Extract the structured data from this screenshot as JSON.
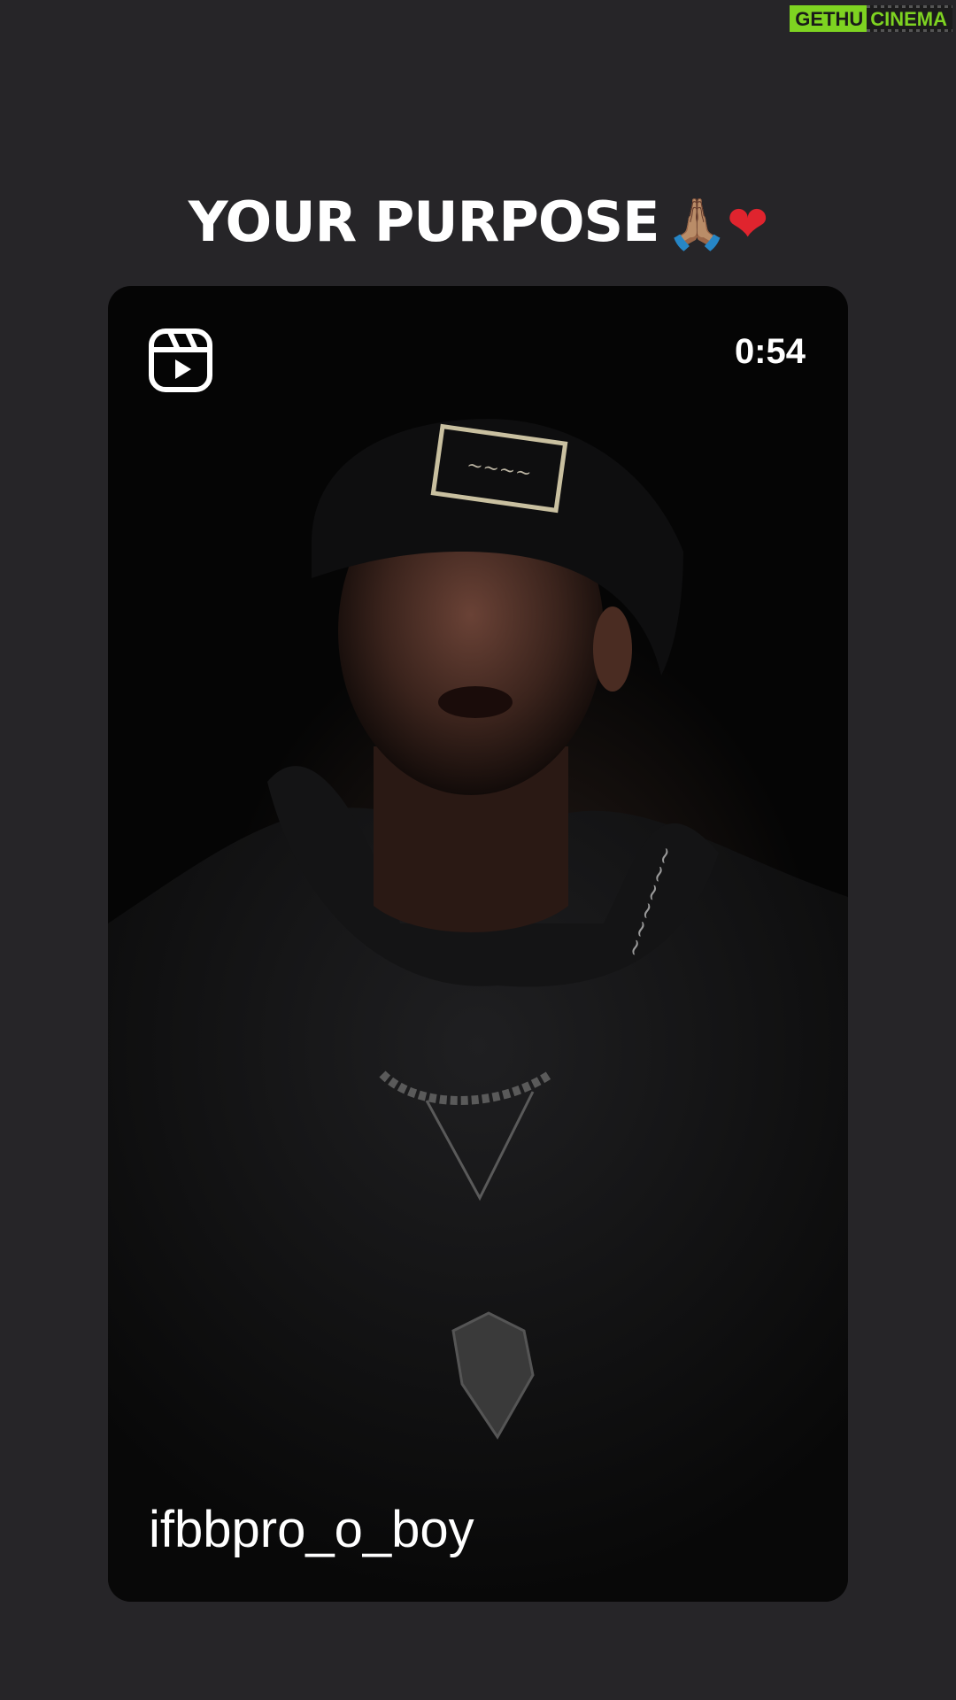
{
  "watermark": {
    "part1": "GETHU",
    "part2": "CINEMA"
  },
  "caption": {
    "text": "YOUR PURPOSE",
    "emoji_pray": "🙏🏽",
    "emoji_heart": "❤"
  },
  "reel": {
    "duration": "0:54",
    "username": "ifbbpro_o_boy",
    "icon": "reels-icon"
  },
  "colors": {
    "background": "#262528",
    "accent_watermark": "#7ed321",
    "heart": "#e0242e"
  }
}
